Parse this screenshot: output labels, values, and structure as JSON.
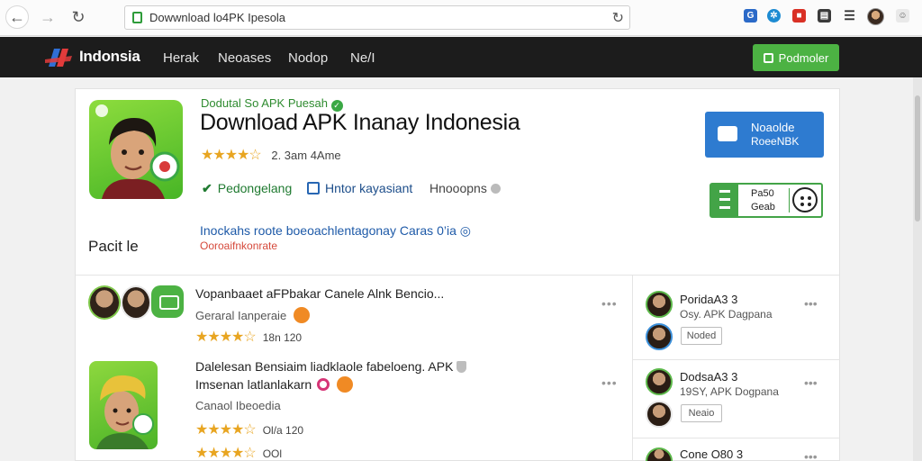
{
  "browser": {
    "url": "Dowwnload lo4PK Ipesola",
    "back_icon": "←",
    "forward_icon": "→",
    "reload_icon": "↻"
  },
  "site": {
    "logo": "Indonsia",
    "nav": [
      "Herak",
      "Neoases",
      "Nodop",
      "Ne/I"
    ],
    "promo_button": "Podmoler"
  },
  "app": {
    "developer": "Dodutal So APK Puesah",
    "title": "Download APK Inanay Indonesia",
    "rating_text": "2. 3am 4Ame",
    "stars": "★★★★☆",
    "meta": [
      "Pedongelang",
      "Hntor kayasiant",
      "Hnooopns"
    ],
    "link_line": "Inockahs roote boeoachlentagonay Caras 0’ia",
    "link_line_red": "Ooroaifnkonrate",
    "side_label": "Pacit le",
    "install_line1": "Noaolde",
    "install_line2": "RoeeNBK",
    "version_line1": "Pa50",
    "version_line2": "Geab"
  },
  "list": [
    {
      "title": "Vopanbaaet aFPbakar Canele Alnk Bencio...",
      "sub": "Geraral Ianperaie",
      "stars": "★★★★☆",
      "rate": "18n  120",
      "more": "•••"
    },
    {
      "title": "Dalelesan Bensiaim liadklaole fabeloeng. APK",
      "title2": "Imsenan latlanlakarn",
      "sub": "Canaol Ibeoedia",
      "stars": "★★★★☆",
      "rate": "Ol/a  120",
      "stars2": "★★★★☆",
      "rate2": "OOl",
      "more": "•••"
    }
  ],
  "side_list": [
    {
      "name": "PoridaA3 3",
      "sub": "Osy. APK Dagpana",
      "button": "Noded",
      "more": "•••"
    },
    {
      "name": "DodsaA3 3",
      "sub": "19SY, APK Dogpana",
      "button": "Neaio",
      "more": "•••"
    },
    {
      "name": "Cone O80 3",
      "more": "•••"
    }
  ]
}
